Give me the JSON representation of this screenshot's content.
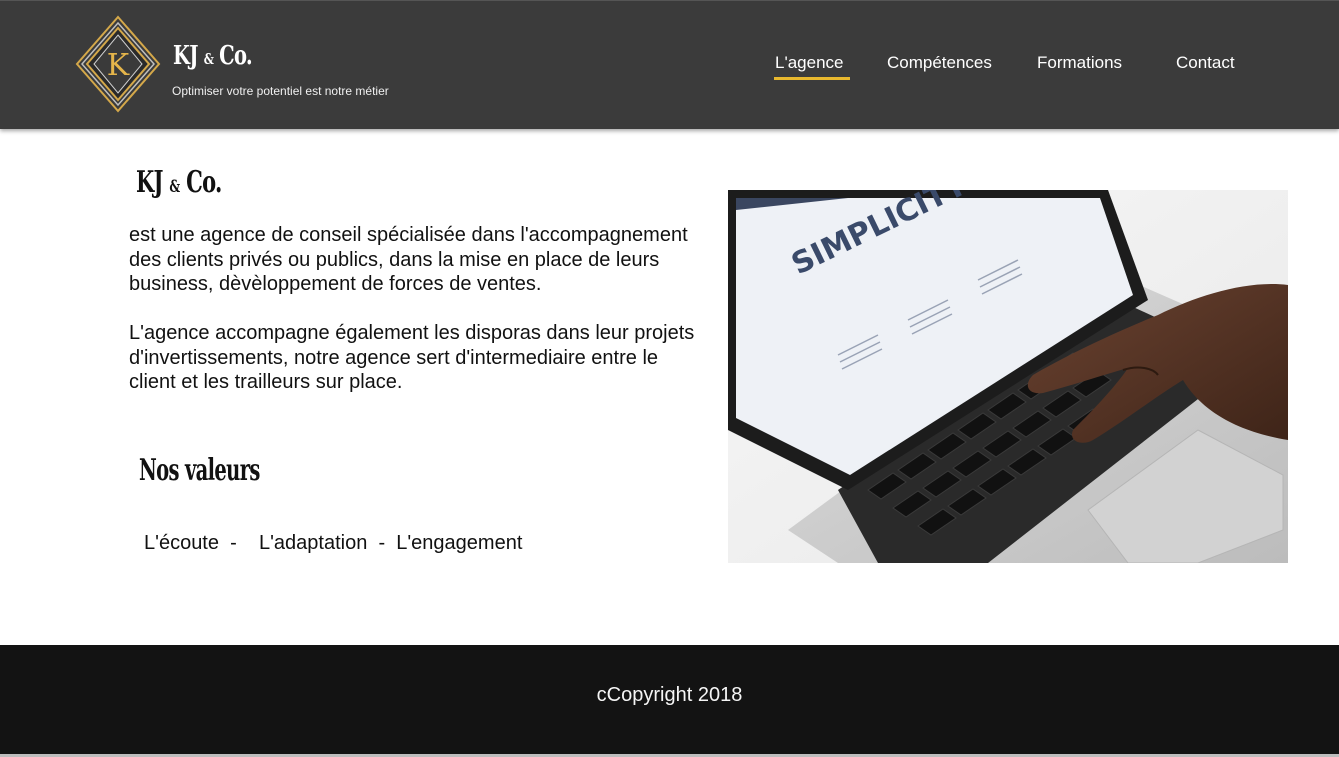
{
  "header": {
    "brand": {
      "main": "KJ",
      "amp": "&",
      "suffix": "Co."
    },
    "logo_letter": "K",
    "tagline": "Optimiser votre potentiel est notre métier",
    "nav": {
      "agence": "L'agence",
      "competences": "Compétences",
      "formations": "Formations",
      "contact": "Contact",
      "active": "L'agence"
    }
  },
  "main": {
    "brand": {
      "main": "KJ",
      "amp": "&",
      "suffix": "Co."
    },
    "paragraph_1": "est une agence de conseil spécialisée dans l'accompagnement des clients privés ou publics, dans la mise en place de leurs business, dèvèloppement de forces de ventes.",
    "paragraph_2": "L'agence accompagne également les disporas dans leur projets d'invertissements, notre agence sert d'intermediaire entre le client et les trailleurs sur place.",
    "values_heading": "Nos valeurs",
    "values_line": "L'écoute  -    L'adaptation  -  L'engagement",
    "photo": {
      "screen_text": "SIMPLICITY",
      "icon": "laptop-typing-photo"
    }
  },
  "footer": {
    "copyright": "cCopyright 2018"
  },
  "colors": {
    "header_bg": "#3b3b3b",
    "accent_gold": "#e8b82e",
    "footer_bg": "#131313"
  }
}
